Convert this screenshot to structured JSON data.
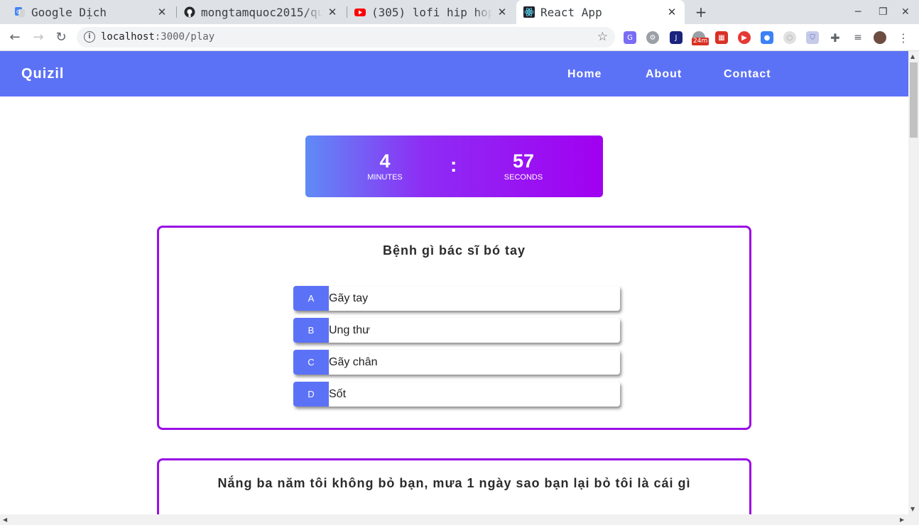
{
  "browser": {
    "tabs": [
      {
        "title": "Google Dịch",
        "icon": "google-translate-icon"
      },
      {
        "title": "mongtamquoc2015/qu",
        "icon": "github-icon"
      },
      {
        "title": "(305) lofi hip hop",
        "icon": "youtube-icon"
      },
      {
        "title": "React App",
        "icon": "react-icon"
      }
    ],
    "url_host": "localhost",
    "url_rest": ":3000/play",
    "extension_badge": "24m"
  },
  "app": {
    "brand": "Quizil",
    "nav": [
      "Home",
      "About",
      "Contact"
    ],
    "brand_color": "#5c72f6",
    "accent_color": "#9a0ee6"
  },
  "timer": {
    "minutes": "4",
    "minutes_label": "MINUTES",
    "separator": ":",
    "seconds": "57",
    "seconds_label": "SECONDS"
  },
  "questions": [
    {
      "title": "Bệnh gì bác sĩ bó tay",
      "answers": [
        {
          "letter": "A",
          "text": "Gãy tay"
        },
        {
          "letter": "B",
          "text": "Ung thư"
        },
        {
          "letter": "C",
          "text": "Gãy chân"
        },
        {
          "letter": "D",
          "text": "Sốt"
        }
      ]
    },
    {
      "title": "Nắng ba năm tôi không bỏ bạn, mưa 1 ngày sao bạn lại bỏ tôi là cái gì"
    }
  ]
}
